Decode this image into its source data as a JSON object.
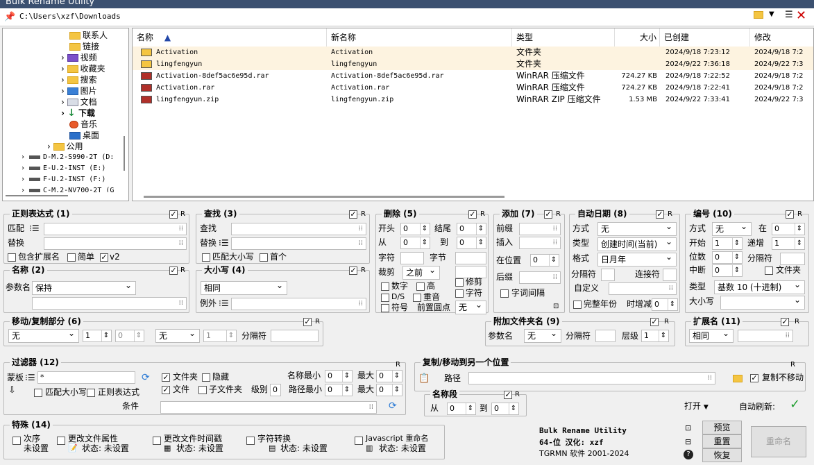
{
  "app": {
    "title": "Bulk Rename Utility"
  },
  "path": {
    "value": "C:\\Users\\xzf\\Downloads"
  },
  "tree": {
    "items": [
      "联系人",
      "链接",
      "视频",
      "收藏夹",
      "搜索",
      "图片",
      "文档",
      "下载",
      "音乐",
      "桌面",
      "公用",
      "D-M.2-S990-2T (D:",
      "E-U.2-INST (E:)",
      "F-U.2-INST (F:)",
      "C-M.2-NV700-2T (G"
    ]
  },
  "files": {
    "headers": {
      "name": "名称",
      "newname": "新名称",
      "type": "类型",
      "size": "大小",
      "created": "已创建",
      "modified": "修改"
    },
    "rows": [
      {
        "name": "Activation",
        "newname": "Activation",
        "type": "文件夹",
        "size": "",
        "created": "2024/9/18 7:23:12",
        "modified": "2024/9/18 7:2"
      },
      {
        "name": "lingfengyun",
        "newname": "lingfengyun",
        "type": "文件夹",
        "size": "",
        "created": "2024/9/22 7:36:18",
        "modified": "2024/9/22 7:3"
      },
      {
        "name": "Activation-8def5ac6e95d.rar",
        "newname": "Activation-8def5ac6e95d.rar",
        "type": "WinRAR 压缩文件",
        "size": "724.27 KB",
        "created": "2024/9/18 7:22:52",
        "modified": "2024/9/18 7:2"
      },
      {
        "name": "Activation.rar",
        "newname": "Activation.rar",
        "type": "WinRAR 压缩文件",
        "size": "724.27 KB",
        "created": "2024/9/18 7:22:41",
        "modified": "2024/9/18 7:2"
      },
      {
        "name": "lingfengyun.zip",
        "newname": "lingfengyun.zip",
        "type": "WinRAR ZIP 压缩文件",
        "size": "1.53 MB",
        "created": "2024/9/22 7:33:41",
        "modified": "2024/9/22 7:3"
      }
    ]
  },
  "regex": {
    "title": "正则表达式 (1)",
    "match": "匹配",
    "replace": "替换",
    "incl_ext": "包含扩展名",
    "simple": "简单",
    "v2": "v2"
  },
  "name": {
    "title": "名称 (2)",
    "param": "参数名",
    "value": "保持"
  },
  "find": {
    "title": "查找 (3)",
    "find": "查找",
    "replace": "替换",
    "match_case": "匹配大小写",
    "first": "首个"
  },
  "case": {
    "title": "大小写 (4)",
    "value": "相同",
    "except": "例外"
  },
  "remove": {
    "title": "删除 (5)",
    "start": "开头",
    "end": "结尾",
    "from": "从",
    "to": "到",
    "chars": "字符",
    "words": "字节",
    "crop": "裁剪",
    "crop_val": "之前",
    "digits": "数字",
    "high": "高",
    "ds": "D/S",
    "dup": "重音",
    "sym": "符号",
    "lead": "前置圆点",
    "lead_val": "无",
    "trim": "修剪",
    "char": "字符",
    "zero": "0"
  },
  "add": {
    "title": "添加 (7)",
    "prefix": "前缀",
    "insert": "插入",
    "at": "在位置",
    "suffix": "后缀",
    "word_space": "字词间隔",
    "zero": "0"
  },
  "autodate": {
    "title": "自动日期 (8)",
    "mode": "方式",
    "mode_val": "无",
    "type": "类型",
    "type_val": "创建时间(当前)",
    "fmt": "格式",
    "fmt_val": "日月年",
    "sep": "分隔符",
    "connect": "连接符",
    "custom": "自定义",
    "full_year": "完整年份",
    "offset": "时增减",
    "zero": "0"
  },
  "numbering": {
    "title": "编号 (10)",
    "mode": "方式",
    "mode_val": "无",
    "at": "在",
    "start": "开始",
    "incr": "递增",
    "pad": "位数",
    "sep": "分隔符",
    "break": "中断",
    "folder": "文件夹",
    "type": "类型",
    "type_val": "基数 10 (十进制)",
    "case": "大小写",
    "zero": "0",
    "one": "1"
  },
  "movecopy": {
    "title": "移动/复制部分 (6)",
    "v1": "无",
    "n1": "1",
    "n2": "0",
    "v2": "无",
    "n3": "1",
    "sep": "分隔符"
  },
  "appendfolder": {
    "title": "附加文件夹名 (9)",
    "param": "参数名",
    "val": "无",
    "sep": "分隔符",
    "level": "层级",
    "one": "1"
  },
  "extension": {
    "title": "扩展名 (11)",
    "val": "相同"
  },
  "filter": {
    "title": "过滤器 (12)",
    "mask": "蒙板",
    "mask_val": "*",
    "folders": "文件夹",
    "hidden": "隐藏",
    "files": "文件",
    "subfolders": "子文件夹",
    "level": "级别",
    "name_min": "名称最小",
    "max": "最大",
    "path_min": "路径最小",
    "match_case": "匹配大小写",
    "regex": "正则表达式",
    "cond": "条件",
    "zero": "0"
  },
  "copymove": {
    "title": "复制/移动到另一个位置",
    "path": "路径",
    "no_move": "复制不移动"
  },
  "segment": {
    "title": "名称段",
    "from": "从",
    "to": "到",
    "zero": "0"
  },
  "special": {
    "title": "特殊 (14)",
    "order": "次序",
    "order_s": "未设置",
    "attr": "更改文件属性",
    "attr_s": "状态: 未设置",
    "time": "更改文件时间戳",
    "time_s": "状态: 未设置",
    "conv": "字符转换",
    "conv_s": "状态: 未设置",
    "js": "Javascript 重命名",
    "js_s": "状态: 未设置"
  },
  "about": {
    "l1": "Bulk Rename Utility",
    "l2": "64-位 汉化: xzf",
    "l3": "TGRMN 软件 2001-2024"
  },
  "actions": {
    "open": "打开",
    "autorefresh": "自动刷新:",
    "preview": "预览",
    "reset": "重置",
    "revert": "恢复",
    "rename": "重命名"
  },
  "r": "R"
}
